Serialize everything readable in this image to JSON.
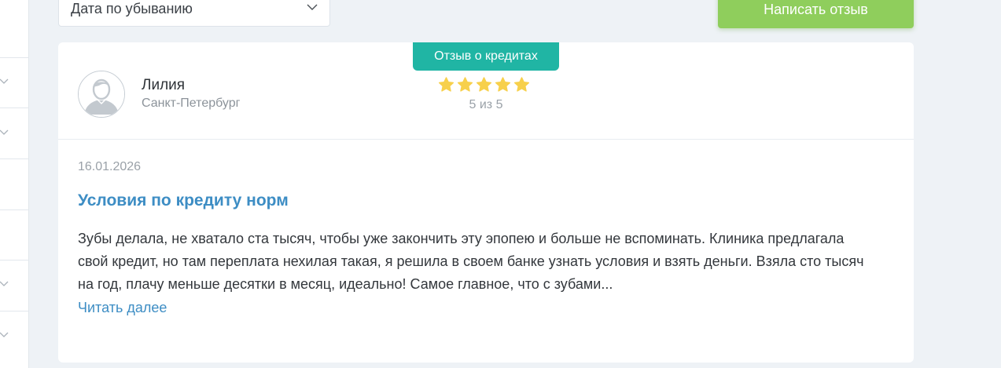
{
  "sort": {
    "selected": "Дата по убыванию"
  },
  "actions": {
    "write_review_label": "Написать отзыв"
  },
  "review": {
    "type_badge": "Отзыв о кредитах",
    "author": {
      "name": "Лилия",
      "city": "Санкт-Петербург"
    },
    "rating": {
      "value": 5,
      "max": 5,
      "text": "5 из 5"
    },
    "date": "16.01.2026",
    "title": "Условия по кредиту норм",
    "text": "Зубы делала, не хватало ста тысяч, чтобы уже закончить эту эпопею и больше не вспоминать. Клиника предлагала свой кредит, но там переплата нехилая такая, я решила в своем банке узнать условия и взять деньги. Взяла сто тысяч на год, плачу меньше десятки в месяц, идеально! Самое главное, что с зубами...",
    "read_more_label": "Читать далее"
  },
  "colors": {
    "accent_green": "#8fce5c",
    "badge_teal": "#20b5a4",
    "link_blue": "#3d8dc4",
    "star_yellow": "#f7d04b",
    "page_bg": "#eef2f6"
  },
  "icons": {
    "dropdown": "chevron-down-icon",
    "avatar": "user-silhouette-icon",
    "rating": "star-icon"
  }
}
